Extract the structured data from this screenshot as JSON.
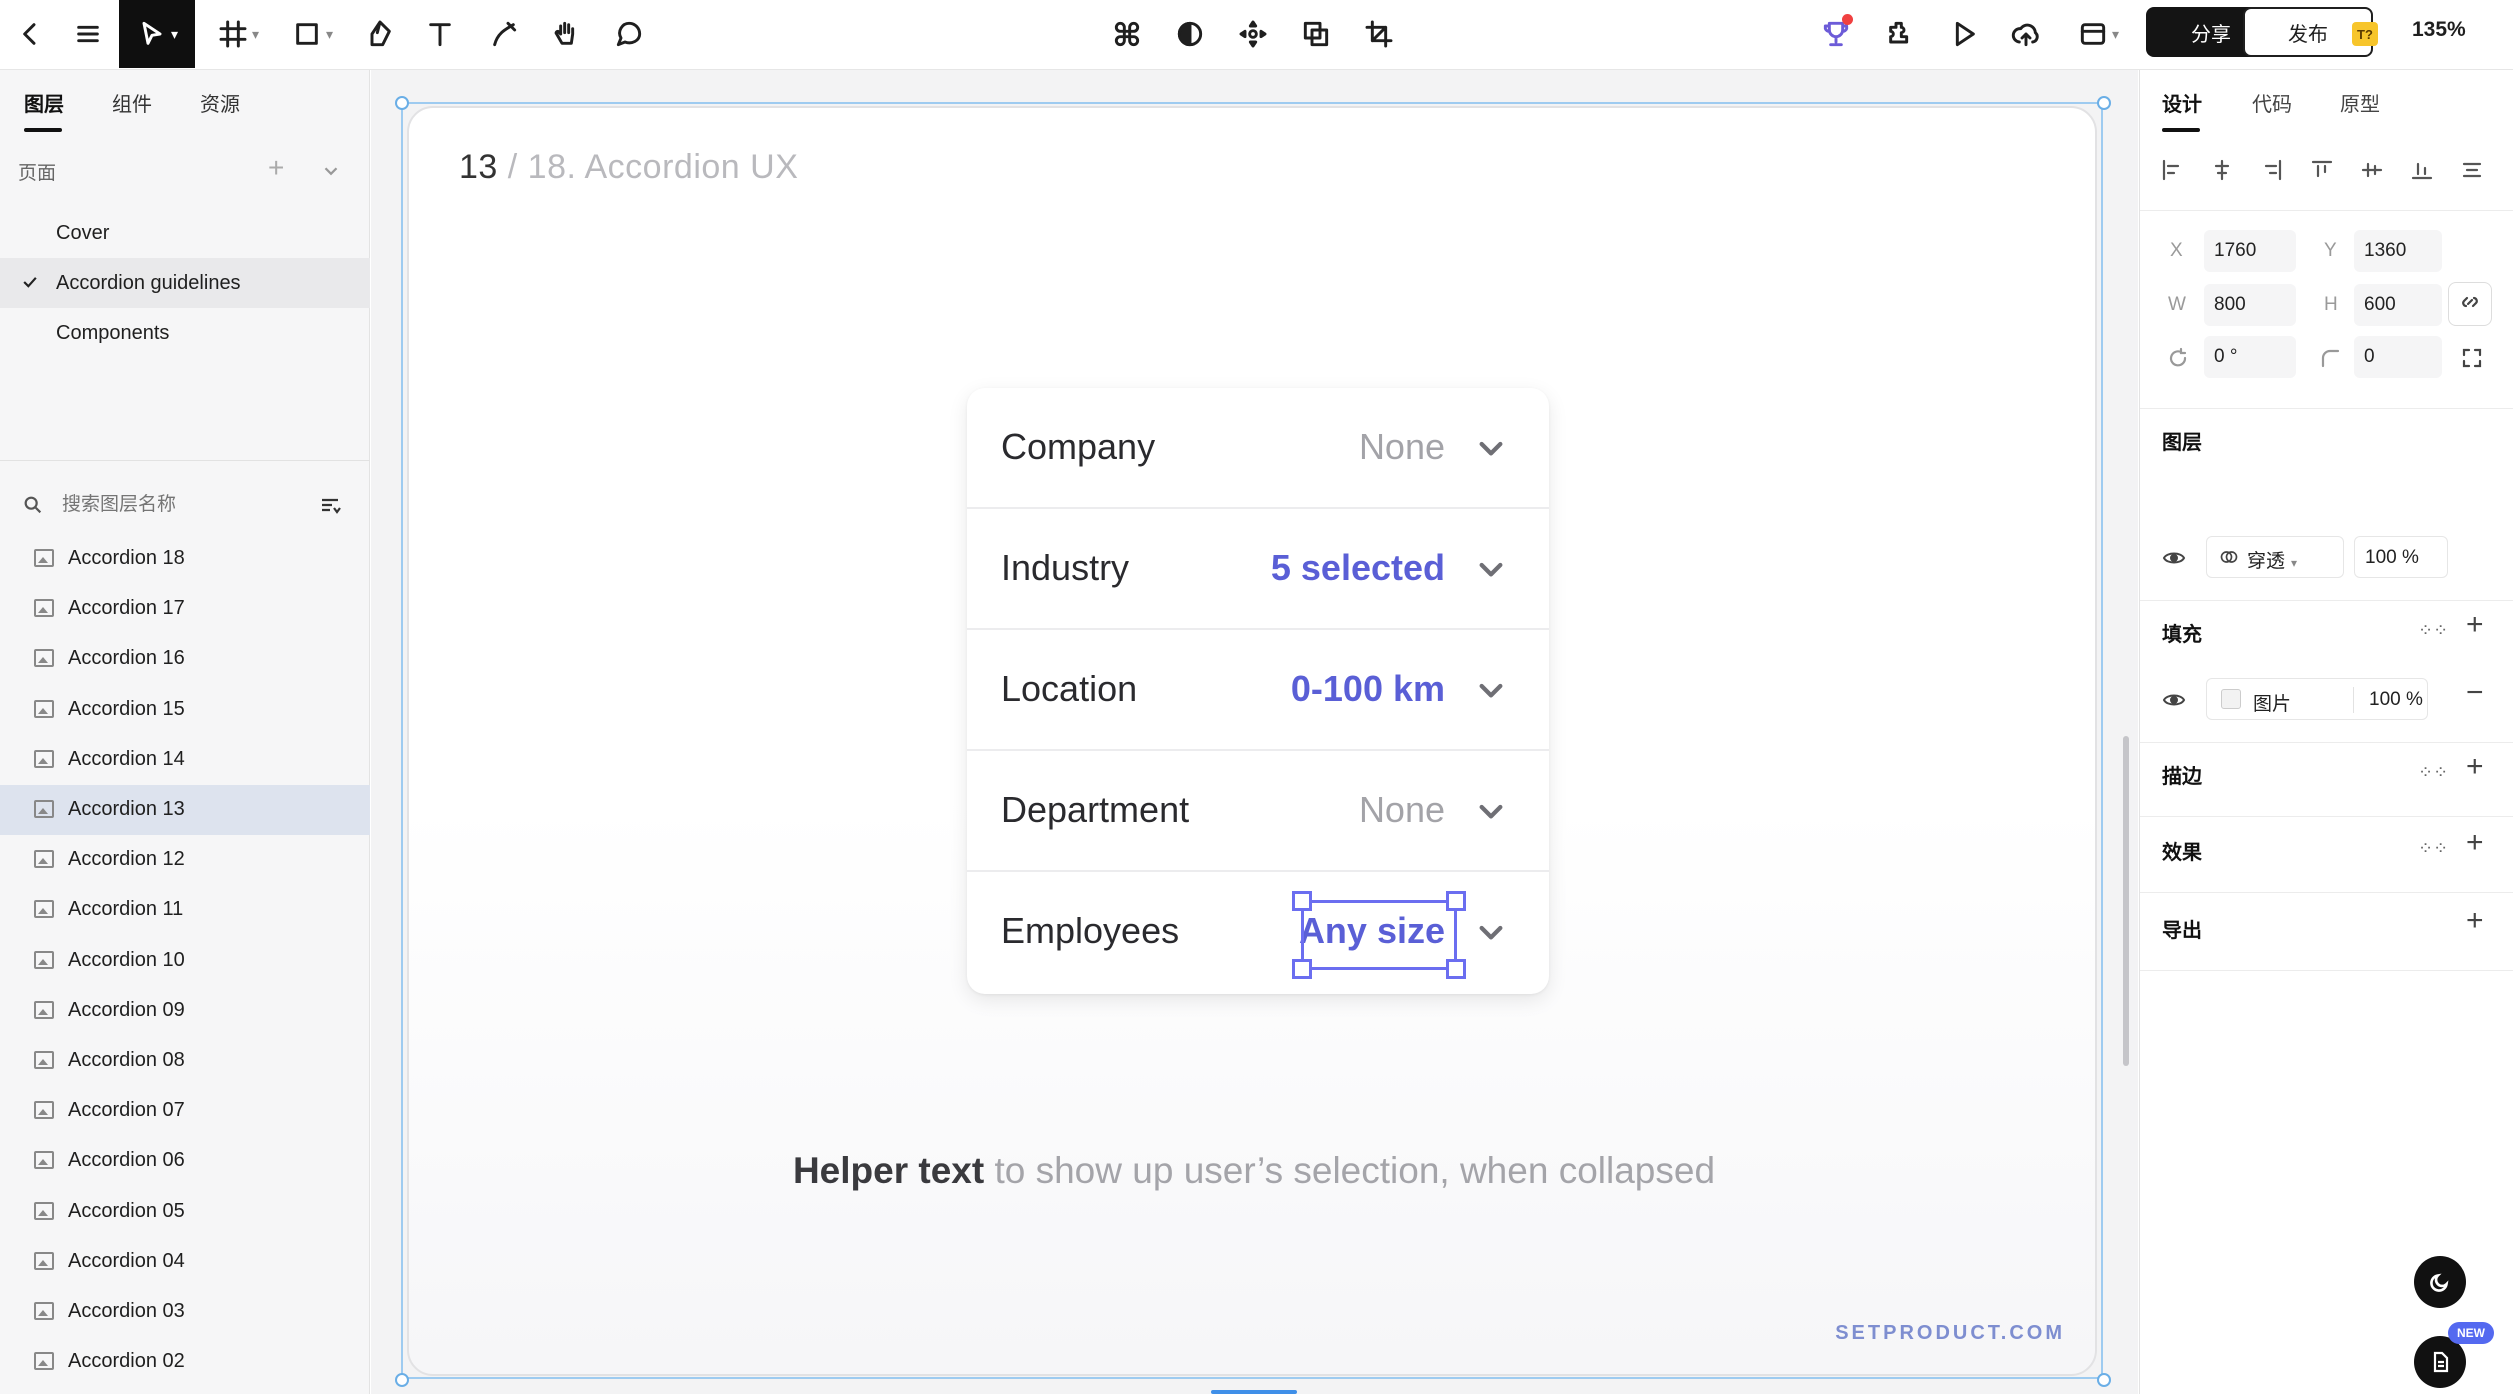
{
  "toolbar": {
    "share_label": "分享",
    "publish_label": "发布",
    "ai_badge": "T?",
    "zoom": "135%"
  },
  "left_panel": {
    "tabs": [
      "图层",
      "组件",
      "资源"
    ],
    "pages_header": "页面",
    "pages": [
      {
        "label": "Cover",
        "selected": false
      },
      {
        "label": "Accordion guidelines",
        "selected": true
      },
      {
        "label": "Components",
        "selected": false
      }
    ],
    "search_placeholder": "搜索图层名称",
    "layers": [
      {
        "label": "Accordion 18"
      },
      {
        "label": "Accordion 17"
      },
      {
        "label": "Accordion 16"
      },
      {
        "label": "Accordion 15"
      },
      {
        "label": "Accordion 14"
      },
      {
        "label": "Accordion 13",
        "selected": true
      },
      {
        "label": "Accordion 12"
      },
      {
        "label": "Accordion 11"
      },
      {
        "label": "Accordion 10"
      },
      {
        "label": "Accordion 09"
      },
      {
        "label": "Accordion 08"
      },
      {
        "label": "Accordion 07"
      },
      {
        "label": "Accordion 06"
      },
      {
        "label": "Accordion 05"
      },
      {
        "label": "Accordion 04"
      },
      {
        "label": "Accordion 03"
      },
      {
        "label": "Accordion 02"
      }
    ]
  },
  "canvas": {
    "frame_number": "13",
    "frame_title": "/ 18. Accordion UX",
    "accordion": [
      {
        "label": "Company",
        "value": "None",
        "selected": false
      },
      {
        "label": "Industry",
        "value": "5 selected",
        "selected": true
      },
      {
        "label": "Location",
        "value": "0-100 km",
        "selected": true
      },
      {
        "label": "Department",
        "value": "None",
        "selected": false
      },
      {
        "label": "Employees",
        "value": "Any size",
        "selected": true
      }
    ],
    "helper_bold": "Helper text",
    "helper_rest": " to show up user’s selection, when collapsed",
    "brand": "SETPRODUCT.COM"
  },
  "right_panel": {
    "tabs": [
      "设计",
      "代码",
      "原型"
    ],
    "x_label": "X",
    "x_value": "1760",
    "y_label": "Y",
    "y_value": "1360",
    "w_label": "W",
    "w_value": "800",
    "h_label": "H",
    "h_value": "600",
    "rotation_value": "0 °",
    "radius_value": "0",
    "layer_section": "图层",
    "blend_mode": "穿透",
    "layer_opacity": "100 %",
    "fill_section": "填充",
    "fill_type": "图片",
    "fill_opacity": "100 %",
    "stroke_section": "描边",
    "effects_section": "效果",
    "export_section": "导出",
    "new_badge": "NEW"
  }
}
